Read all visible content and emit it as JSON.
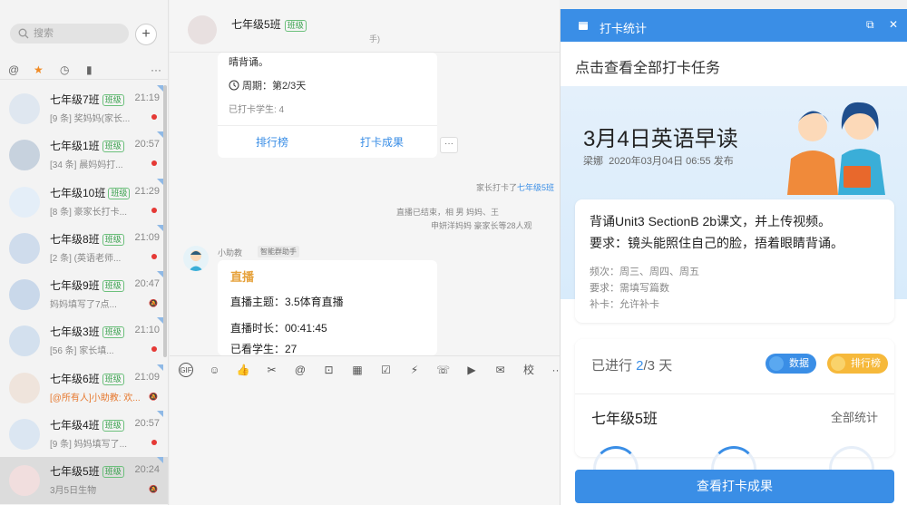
{
  "sidebar": {
    "search_placeholder": "搜索",
    "add_label": "+",
    "tabs": [
      "@",
      "★",
      "◷",
      "▮",
      "···"
    ],
    "conversations": [
      {
        "name": "七年级7班",
        "tag": "班级",
        "time": "21:19",
        "preview": "[9 条] 奖妈妈(家长...",
        "badge": "dot"
      },
      {
        "name": "七年级1班",
        "tag": "班级",
        "time": "20:57",
        "preview": "[34 条] 晨妈妈打...",
        "badge": "dot"
      },
      {
        "name": "七年级10班",
        "tag": "班级",
        "time": "21:29",
        "preview": "[8 条] 豪家长打卡...",
        "badge": "dot"
      },
      {
        "name": "七年级8班",
        "tag": "班级",
        "time": "21:09",
        "preview": "[2 条] (英语老师...",
        "badge": "dot"
      },
      {
        "name": "七年级9班",
        "tag": "班级",
        "time": "20:47",
        "preview": "妈妈填写了7点...",
        "badge": "mute"
      },
      {
        "name": "七年级3班",
        "tag": "班级",
        "time": "21:10",
        "preview": "[56 条] 家长填...",
        "badge": "dot"
      },
      {
        "name": "七年级6班",
        "tag": "班级",
        "time": "21:09",
        "preview": "[@所有人]小助教: 欢...",
        "badge": "mute",
        "highlight": true
      },
      {
        "name": "七年级4班",
        "tag": "班级",
        "time": "20:57",
        "preview": "[9 条] 妈妈填写了...",
        "badge": "dot"
      },
      {
        "name": "七年级5班",
        "tag": "班级",
        "time": "20:24",
        "preview": "3月5日生物",
        "badge": "mute",
        "active": true
      }
    ]
  },
  "chat": {
    "title": "七年级5班",
    "title_tag": "班级",
    "subtitle": "手)",
    "checkin_msg": {
      "top_text": "晴背诵。",
      "period": "周期：第2/3天",
      "checked": "已打卡学生: 4",
      "link_rank": "排行榜",
      "link_result": "打卡成果"
    },
    "more_label": "···",
    "sys1_pre": "家长打卡了",
    "sys1_link": "七年级5班",
    "sys2": "直播已结束，相  男  妈妈、王",
    "sys3": "申妍洋妈妈  豪家长等28人观",
    "bot_name": "小助教",
    "bot_tag": "智能群助手",
    "live_msg": {
      "title": "直播",
      "topic": "直播主题：3.5体育直播",
      "duration": "直播时长：00:41:45",
      "viewers": "已看学生：27"
    },
    "toolbar": [
      "GIF",
      "☺",
      "👍",
      "✂",
      "@",
      "⊡",
      "▦",
      "☑",
      "⚡",
      "☏",
      "▶",
      "✉",
      "校",
      "···"
    ]
  },
  "panel": {
    "header_title": "打卡统计",
    "view_all": "点击查看全部打卡任务",
    "task_title": "3月4日英语早读",
    "author": "梁娜",
    "published": "2020年03月04日 06:55 发布",
    "desc_line1": "背诵Unit3 SectionB 2b课文，并上传视频。",
    "desc_line2": "要求：镜头能照住自己的脸，捂着眼睛背诵。",
    "frequency": "频次：周三、周四、周五",
    "requirement": "要求：需填写篇数",
    "makeup": "补卡：允许补卡",
    "progress_pre": "已进行 ",
    "progress_num": "2",
    "progress_post": "/3 天",
    "btn_data": "数据",
    "btn_rank": "排行榜",
    "class_name": "七年级5班",
    "all_stats": "全部统计",
    "bottom_button": "查看打卡成果"
  },
  "colors": {
    "accent": "#3a8ee6",
    "tag_green": "#3aa14e",
    "gold": "#f6b93b"
  }
}
